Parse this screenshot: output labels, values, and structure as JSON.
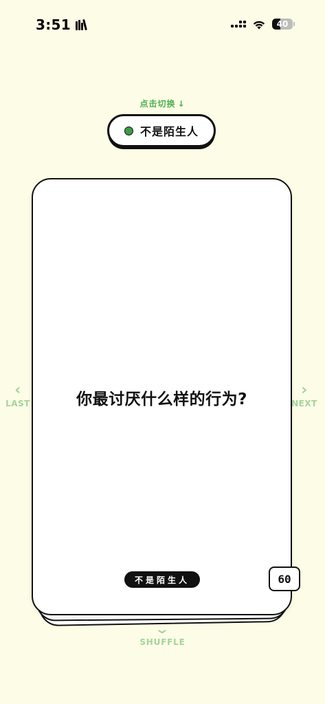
{
  "status_bar": {
    "time": "3:51",
    "battery": "40",
    "battery_level": 0.4
  },
  "header": {
    "switch_hint": "点击切换",
    "switch_hint_arrow": "↓",
    "category_label": "不是陌生人",
    "category_color": "#3B9C43"
  },
  "card": {
    "question": "你最讨厌什么样的行为?",
    "tag": "不是陌生人",
    "count": "60"
  },
  "nav": {
    "last_label": "LAST",
    "next_label": "NEXT",
    "shuffle_label": "SHUFFLE",
    "last_chevron": "‹",
    "next_chevron": "›",
    "shuffle_chevron": "⌄"
  },
  "colors": {
    "background": "#FDFCE6",
    "accent_green": "#4CAF50",
    "nav_green": "#A3D49C"
  }
}
